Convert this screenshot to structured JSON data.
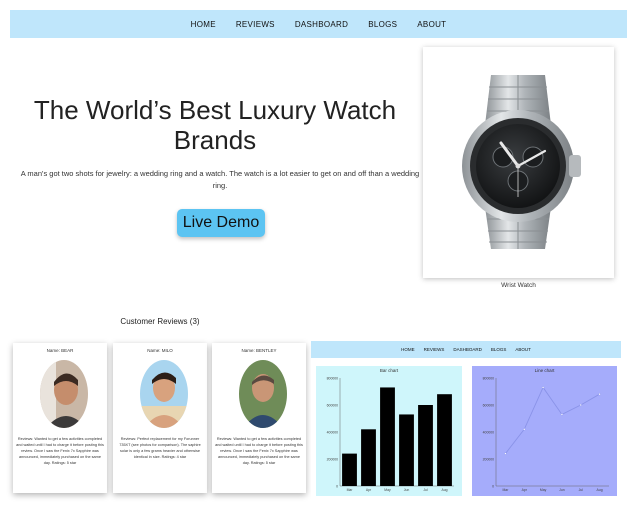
{
  "nav": {
    "items": [
      "HOME",
      "REVIEWS",
      "DASHBOARD",
      "BLOGS",
      "ABOUT"
    ]
  },
  "hero": {
    "title": "The World’s Best Luxury Watch Brands",
    "text": "A man's got two shots for jewelry: a wedding ring and a watch. The watch is a lot easier to get on and off than a wedding ring.",
    "button": "Live Demo",
    "image_caption": "Wrist Watch"
  },
  "reviews": {
    "heading": "Customer Reviews (3)",
    "items": [
      {
        "name": "Name: BEAR",
        "text": "Reviews: Wanted to get a few activities completed and waited until I had to charge it before posting this review. Once I saw the Fenix 7x Sapphire was announced, immediately purchased on the same day. Ratings: 5 star"
      },
      {
        "name": "Name: MILO",
        "text": "Reviews: Perfect replacement for my Forunner 735XT (see photos for comparison). The saphire solar is only a few grams heavier and otherwise identical in size. Ratings: 4 star"
      },
      {
        "name": "Name: BENTLEY",
        "text": "Reviews: Wanted to get a few activities completed and waited until I had to charge it before posting this review. Once I saw the Fenix 7x Sapphire was announced, immediately purchased on the same day. Ratings: 5 star"
      }
    ]
  },
  "dashboard": {
    "nav": [
      "HOME",
      "REVIEWS",
      "DASHBOARD",
      "BLOGS",
      "ABOUT"
    ]
  },
  "chart_data": [
    {
      "type": "bar",
      "title": "Bar chart",
      "categories": [
        "Mar",
        "Apr",
        "May",
        "Jun",
        "Jul",
        "Aug"
      ],
      "values": [
        240000,
        420000,
        730000,
        530000,
        600000,
        680000
      ],
      "ylim": [
        0,
        800000
      ],
      "yticks": [
        "0",
        "200000",
        "400000",
        "600000",
        "800000"
      ],
      "color": "#000000",
      "background": "#cff6fb"
    },
    {
      "type": "line",
      "title": "Line chart",
      "categories": [
        "Mar",
        "Apr",
        "May",
        "Jun",
        "Jul",
        "Aug"
      ],
      "values": [
        240000,
        420000,
        730000,
        530000,
        600000,
        680000
      ],
      "ylim": [
        0,
        800000
      ],
      "yticks": [
        "0",
        "200000",
        "400000",
        "600000",
        "800000"
      ],
      "color": "#8a93e8",
      "background": "#a5acfb"
    }
  ]
}
